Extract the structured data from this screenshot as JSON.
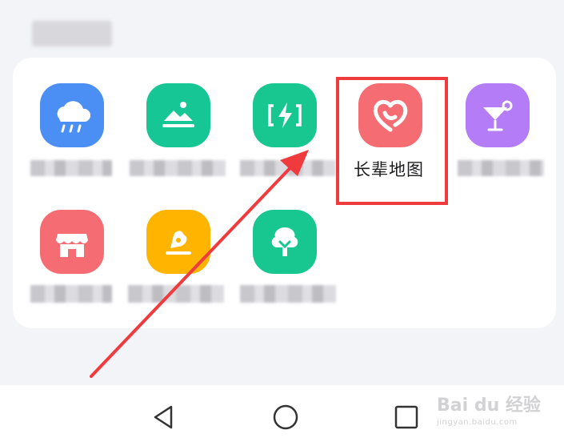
{
  "apps": [
    {
      "name": "weather",
      "icon": "weather-rain-icon",
      "color": "#4b8ff5"
    },
    {
      "name": "gallery",
      "icon": "landscape-icon",
      "color": "#16c795"
    },
    {
      "name": "speed",
      "icon": "lightning-icon",
      "color": "#17c78f"
    },
    {
      "name": "elder-map",
      "icon": "heart-icon",
      "color": "#f56d73",
      "label": "长辈地图"
    },
    {
      "name": "drinks",
      "icon": "cocktail-icon",
      "color": "#b57cf7"
    },
    {
      "name": "shop",
      "icon": "storefront-icon",
      "color": "#f56d73"
    },
    {
      "name": "hand",
      "icon": "hand-icon",
      "color": "#ffb400"
    },
    {
      "name": "tree",
      "icon": "tree-icon",
      "color": "#17c78f"
    }
  ],
  "highlight_color": "#ef3b3e",
  "navbar": {
    "back_icon": "back-triangle-icon",
    "home_icon": "home-circle-icon",
    "recents_icon": "recents-square-icon"
  },
  "watermark": {
    "main": "Bai du 经验",
    "sub": "jingyan.baidu.com"
  }
}
